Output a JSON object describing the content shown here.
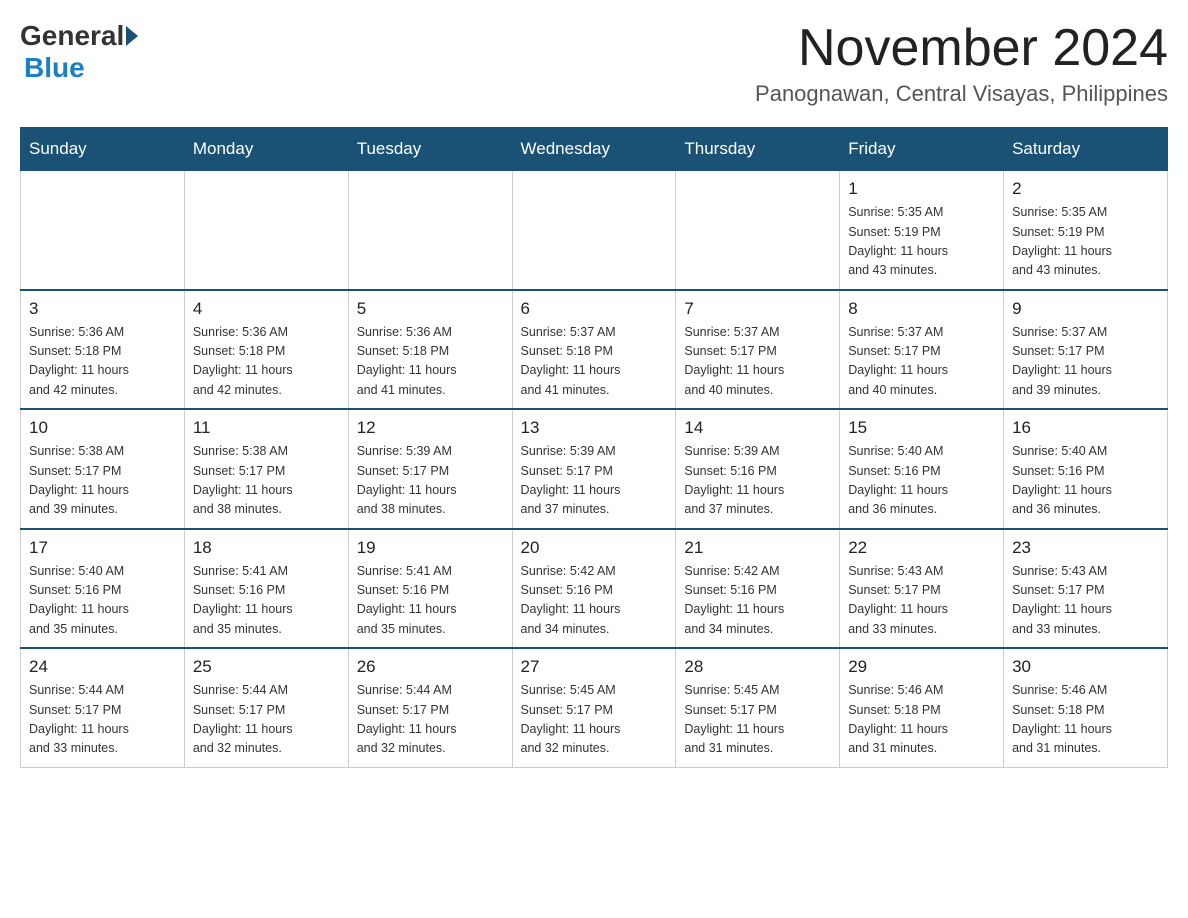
{
  "header": {
    "logo": {
      "general": "General",
      "blue": "Blue"
    },
    "title": "November 2024",
    "location": "Panognawan, Central Visayas, Philippines"
  },
  "calendar": {
    "days_of_week": [
      "Sunday",
      "Monday",
      "Tuesday",
      "Wednesday",
      "Thursday",
      "Friday",
      "Saturday"
    ],
    "weeks": [
      [
        {
          "day": "",
          "info": ""
        },
        {
          "day": "",
          "info": ""
        },
        {
          "day": "",
          "info": ""
        },
        {
          "day": "",
          "info": ""
        },
        {
          "day": "",
          "info": ""
        },
        {
          "day": "1",
          "info": "Sunrise: 5:35 AM\nSunset: 5:19 PM\nDaylight: 11 hours\nand 43 minutes."
        },
        {
          "day": "2",
          "info": "Sunrise: 5:35 AM\nSunset: 5:19 PM\nDaylight: 11 hours\nand 43 minutes."
        }
      ],
      [
        {
          "day": "3",
          "info": "Sunrise: 5:36 AM\nSunset: 5:18 PM\nDaylight: 11 hours\nand 42 minutes."
        },
        {
          "day": "4",
          "info": "Sunrise: 5:36 AM\nSunset: 5:18 PM\nDaylight: 11 hours\nand 42 minutes."
        },
        {
          "day": "5",
          "info": "Sunrise: 5:36 AM\nSunset: 5:18 PM\nDaylight: 11 hours\nand 41 minutes."
        },
        {
          "day": "6",
          "info": "Sunrise: 5:37 AM\nSunset: 5:18 PM\nDaylight: 11 hours\nand 41 minutes."
        },
        {
          "day": "7",
          "info": "Sunrise: 5:37 AM\nSunset: 5:17 PM\nDaylight: 11 hours\nand 40 minutes."
        },
        {
          "day": "8",
          "info": "Sunrise: 5:37 AM\nSunset: 5:17 PM\nDaylight: 11 hours\nand 40 minutes."
        },
        {
          "day": "9",
          "info": "Sunrise: 5:37 AM\nSunset: 5:17 PM\nDaylight: 11 hours\nand 39 minutes."
        }
      ],
      [
        {
          "day": "10",
          "info": "Sunrise: 5:38 AM\nSunset: 5:17 PM\nDaylight: 11 hours\nand 39 minutes."
        },
        {
          "day": "11",
          "info": "Sunrise: 5:38 AM\nSunset: 5:17 PM\nDaylight: 11 hours\nand 38 minutes."
        },
        {
          "day": "12",
          "info": "Sunrise: 5:39 AM\nSunset: 5:17 PM\nDaylight: 11 hours\nand 38 minutes."
        },
        {
          "day": "13",
          "info": "Sunrise: 5:39 AM\nSunset: 5:17 PM\nDaylight: 11 hours\nand 37 minutes."
        },
        {
          "day": "14",
          "info": "Sunrise: 5:39 AM\nSunset: 5:16 PM\nDaylight: 11 hours\nand 37 minutes."
        },
        {
          "day": "15",
          "info": "Sunrise: 5:40 AM\nSunset: 5:16 PM\nDaylight: 11 hours\nand 36 minutes."
        },
        {
          "day": "16",
          "info": "Sunrise: 5:40 AM\nSunset: 5:16 PM\nDaylight: 11 hours\nand 36 minutes."
        }
      ],
      [
        {
          "day": "17",
          "info": "Sunrise: 5:40 AM\nSunset: 5:16 PM\nDaylight: 11 hours\nand 35 minutes."
        },
        {
          "day": "18",
          "info": "Sunrise: 5:41 AM\nSunset: 5:16 PM\nDaylight: 11 hours\nand 35 minutes."
        },
        {
          "day": "19",
          "info": "Sunrise: 5:41 AM\nSunset: 5:16 PM\nDaylight: 11 hours\nand 35 minutes."
        },
        {
          "day": "20",
          "info": "Sunrise: 5:42 AM\nSunset: 5:16 PM\nDaylight: 11 hours\nand 34 minutes."
        },
        {
          "day": "21",
          "info": "Sunrise: 5:42 AM\nSunset: 5:16 PM\nDaylight: 11 hours\nand 34 minutes."
        },
        {
          "day": "22",
          "info": "Sunrise: 5:43 AM\nSunset: 5:17 PM\nDaylight: 11 hours\nand 33 minutes."
        },
        {
          "day": "23",
          "info": "Sunrise: 5:43 AM\nSunset: 5:17 PM\nDaylight: 11 hours\nand 33 minutes."
        }
      ],
      [
        {
          "day": "24",
          "info": "Sunrise: 5:44 AM\nSunset: 5:17 PM\nDaylight: 11 hours\nand 33 minutes."
        },
        {
          "day": "25",
          "info": "Sunrise: 5:44 AM\nSunset: 5:17 PM\nDaylight: 11 hours\nand 32 minutes."
        },
        {
          "day": "26",
          "info": "Sunrise: 5:44 AM\nSunset: 5:17 PM\nDaylight: 11 hours\nand 32 minutes."
        },
        {
          "day": "27",
          "info": "Sunrise: 5:45 AM\nSunset: 5:17 PM\nDaylight: 11 hours\nand 32 minutes."
        },
        {
          "day": "28",
          "info": "Sunrise: 5:45 AM\nSunset: 5:17 PM\nDaylight: 11 hours\nand 31 minutes."
        },
        {
          "day": "29",
          "info": "Sunrise: 5:46 AM\nSunset: 5:18 PM\nDaylight: 11 hours\nand 31 minutes."
        },
        {
          "day": "30",
          "info": "Sunrise: 5:46 AM\nSunset: 5:18 PM\nDaylight: 11 hours\nand 31 minutes."
        }
      ]
    ]
  }
}
